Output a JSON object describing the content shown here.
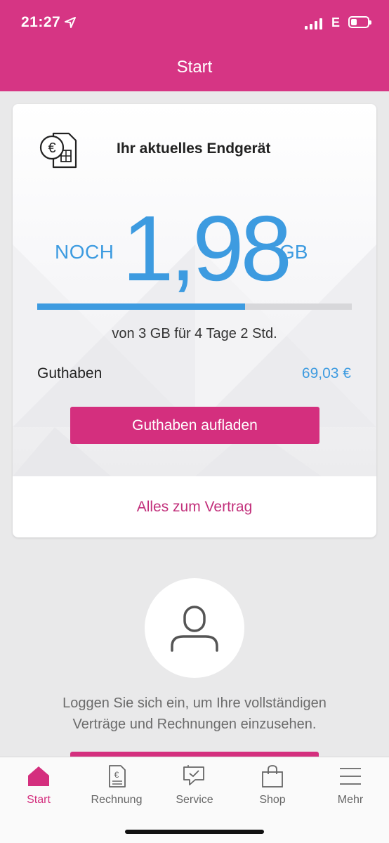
{
  "status_bar": {
    "time": "21:27",
    "network": "E",
    "battery_level": 0.35
  },
  "header": {
    "title": "Start"
  },
  "card": {
    "title": "Ihr aktuelles Endgerät",
    "data_prefix": "NOCH",
    "data_remaining": "1,98",
    "data_unit": "GB",
    "usage_fraction": 0.66,
    "usage_text": "von 3 GB für 4 Tage 2 Std.",
    "balance_label": "Guthaben",
    "balance_value": "69,03 €",
    "topup_button": "Guthaben aufladen",
    "contract_link": "Alles zum Vertrag"
  },
  "login": {
    "text_line1": "Loggen Sie sich ein, um Ihre vollständigen",
    "text_line2": "Verträge und Rechnungen einzusehen."
  },
  "tabbar": {
    "items": [
      {
        "label": "Start",
        "icon": "home-icon",
        "active": true
      },
      {
        "label": "Rechnung",
        "icon": "invoice-icon",
        "active": false
      },
      {
        "label": "Service",
        "icon": "service-chat-icon",
        "active": false
      },
      {
        "label": "Shop",
        "icon": "shopping-bag-icon",
        "active": false
      },
      {
        "label": "Mehr",
        "icon": "menu-icon",
        "active": false
      }
    ]
  },
  "colors": {
    "brand_magenta": "#d63584",
    "accent_blue": "#3d9be0",
    "background": "#e9e9ea"
  }
}
